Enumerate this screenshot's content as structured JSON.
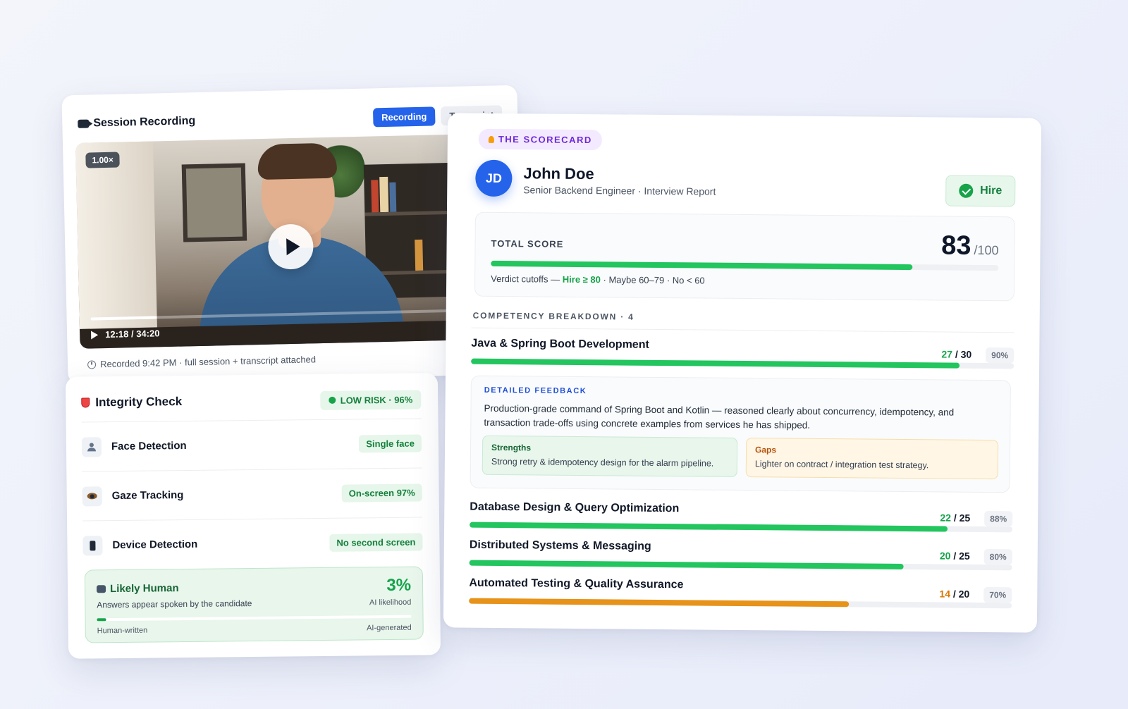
{
  "recording": {
    "title": "Session Recording",
    "tabs": [
      {
        "label": "Recording",
        "active": true
      },
      {
        "label": "Transcript",
        "active": false
      }
    ],
    "speed": "1.00×",
    "time": "12:18 / 34:20",
    "progress": 0.18,
    "footer": "Recorded 9:42 PM · full session + transcript attached"
  },
  "integrity": {
    "title": "Integrity Check",
    "risk": "LOW RISK · 96%",
    "checks": [
      {
        "label": "Face Detection",
        "value": "Single face",
        "icon": "user-icon"
      },
      {
        "label": "Gaze Tracking",
        "value": "On-screen 97%",
        "icon": "eye-icon"
      },
      {
        "label": "Device Detection",
        "value": "No second screen",
        "icon": "phone-icon"
      }
    ],
    "human": {
      "title": "Likely Human",
      "subtitle": "Answers appear spoken by the candidate",
      "percent": "3%",
      "percent_label": "AI likelihood",
      "level": 0.03,
      "left_label": "Human-written",
      "right_label": "AI-generated"
    }
  },
  "scorecard": {
    "tag": "THE SCORECARD",
    "initials": "JD",
    "name": "John Doe",
    "subtitle": "Senior Backend Engineer · Interview Report",
    "verdict": "Hire",
    "total_label": "TOTAL SCORE",
    "total": "83",
    "total_max": "/100",
    "total_fraction": 0.83,
    "cutoff_prefix": "Verdict cutoffs —",
    "cutoff_hire": "Hire ≥ 80",
    "cutoff_rest": "· Maybe 60–79 · No < 60",
    "breakdown_label": "COMPETENCY BREAKDOWN · 4",
    "competencies": [
      {
        "name": "Java & Spring Boot Development",
        "got": "27",
        "max": "/ 30",
        "pct": "90%",
        "fraction": 0.9,
        "warn": false
      },
      {
        "name": "Database Design & Query Optimization",
        "got": "22",
        "max": "/ 25",
        "pct": "88%",
        "fraction": 0.88,
        "warn": false
      },
      {
        "name": "Distributed Systems & Messaging",
        "got": "20",
        "max": "/ 25",
        "pct": "80%",
        "fraction": 0.8,
        "warn": false
      },
      {
        "name": "Automated Testing & Quality Assurance",
        "got": "14",
        "max": "/ 20",
        "pct": "70%",
        "fraction": 0.7,
        "warn": true
      }
    ],
    "feedback": {
      "label": "DETAILED FEEDBACK",
      "text": "Production-grade command of Spring Boot and Kotlin — reasoned clearly about concurrency, idempotency, and transaction trade-offs using concrete examples from services he has shipped.",
      "strengths_title": "Strengths",
      "strengths": "Strong retry & idempotency design for the alarm pipeline.",
      "gaps_title": "Gaps",
      "gaps": "Lighter on contract / integration test strategy."
    }
  },
  "colors": {
    "accent": "#2563eb",
    "success": "#16a34a",
    "warning": "#e79219",
    "tag": "#6d28d9"
  }
}
